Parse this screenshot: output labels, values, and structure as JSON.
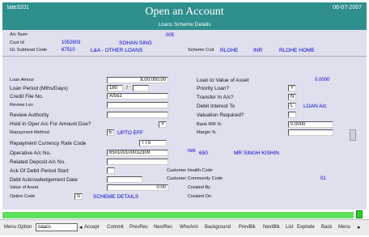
{
  "window": {
    "id_text": "late3201",
    "title": "Open an Account",
    "date": "06-07-2007",
    "subtitle": "Loans Scheme Details"
  },
  "header": {
    "acnum_label": "A/c Num:",
    "acnum_value": "",
    "code_005": "005",
    "custid_label": "Cust Id",
    "custid_value": "1052603",
    "cust_name": "SOHAN SING",
    "gl_label": "GL Subhead Code",
    "gl_value": "67510",
    "gl_desc": "L&A - OTHER LOANS",
    "scheme_label": "Scheme Cod",
    "scheme_code": "RLOHE",
    "currency": "INR",
    "scheme_desc": "RLOHE HOME"
  },
  "form": {
    "loan_amount_label": "Loan Amour",
    "loan_amount_value": "8,00,000.00",
    "loan_period_label": "Loan Period (Mths/Days)",
    "loan_period_months": "180",
    "loan_period_sep": "/",
    "loan_period_days": "",
    "credit_file_label": "Credit File No.",
    "credit_file_value": "A/552",
    "review_lev_label": "Review Lev",
    "review_lev_value": "",
    "review_auth_label": "Review Authority",
    "review_auth_value": "",
    "hold_label": "Hold In Oper A/c For Amount Due?",
    "hold_value": "Y",
    "repay_method_label": "Repayment Method",
    "repay_method_code": "E",
    "repay_method_desc": "UPTO EFF",
    "ltv_label": "Loan to Value of Asset",
    "ltv_value": "0.0000",
    "priority_label": "Priority Loan?",
    "priority_value": "Y",
    "transfer_label": "Transfer In A/c?",
    "transfer_value": "N",
    "debit_label": "Debit Interest To",
    "debit_value": "L",
    "debit_desc": "LOAN A/c",
    "valuation_label": "Valuation Required?",
    "valuation_value": "",
    "bank_irr_label": "Bank IRR %",
    "bank_irr_value": "0.0000",
    "margin_label": "Margin %",
    "margin_value": "",
    "rcr_label": "Repayment Currency Rate Code",
    "rcr_value": "TTS",
    "operative_label": "Operative A/c No.",
    "operative_value": "650100100032309",
    "operative_ccy": "INR",
    "operative_sol": "650",
    "operative_name": "MR SINGH KISHIN",
    "related_label": "Related Deposit A/c No.",
    "related_value": "",
    "ack_label": "Ack Of Debit Period Start",
    "ack_value": "",
    "debt_ack_label": "Debt Acknowledgement Date",
    "debt_ack_value": "",
    "value_asset_label": "Value of Asset",
    "value_asset_value": "0.00",
    "option_label": "Option Code",
    "option_value": "S",
    "option_desc": "SCHEME DETAILS",
    "health_label": "Customer Health Code",
    "community_label": "Customer Community Code",
    "community_value": "01",
    "created_by_label": "Created By",
    "created_on_label": "Created On"
  },
  "toolbar": {
    "menu_option_label": "Menu Option",
    "menu_option_value": "oaacs",
    "left_arrow": "◂",
    "right_arrow": "▸",
    "items": [
      "Accept",
      "Commit",
      "PrevRec",
      "NextRec",
      "WhoAml",
      "Background",
      "PrevBlk",
      "NextBlk",
      "List",
      "Explode",
      "Back",
      "Menu"
    ]
  },
  "colors": {
    "title_bg": "#2f8f8d",
    "panel_bg": "#dfe0ee",
    "value_text": "#0000c8",
    "status_green": "#5de05d"
  }
}
